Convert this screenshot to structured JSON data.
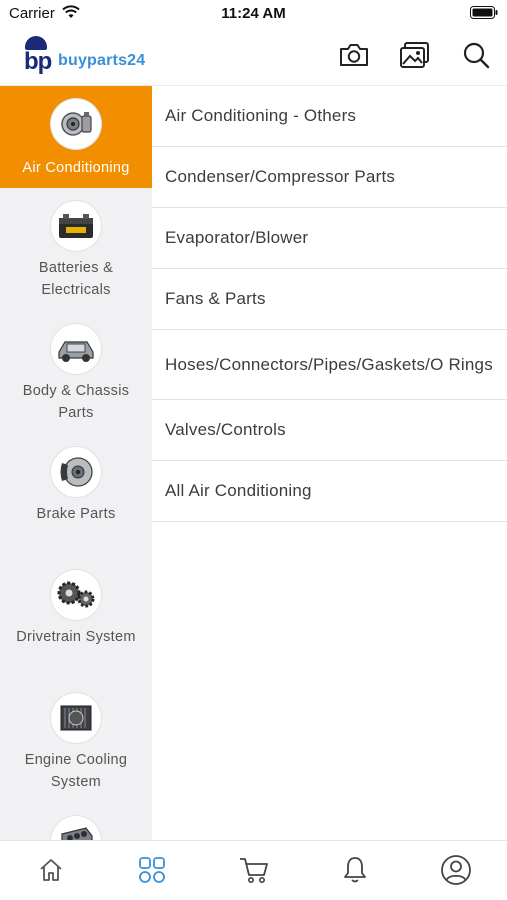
{
  "status_bar": {
    "carrier": "Carrier",
    "time": "11:24 AM"
  },
  "header": {
    "logo_mark": "bp",
    "logo_text": "buyparts",
    "logo_num": "24",
    "icons": [
      "camera-icon",
      "gallery-icon",
      "search-icon"
    ]
  },
  "categories": [
    {
      "label": "Air Conditioning",
      "icon": "ac-compressor-icon",
      "active": true
    },
    {
      "label": "Batteries & Electricals",
      "icon": "battery-icon"
    },
    {
      "label": "Body & Chassis Parts",
      "icon": "chassis-icon"
    },
    {
      "label": "Brake Parts",
      "icon": "brake-disc-icon"
    },
    {
      "label": "Drivetrain System",
      "icon": "gears-icon"
    },
    {
      "label": "Engine Cooling System",
      "icon": "radiator-icon"
    },
    {
      "label": "",
      "icon": "engine-block-icon"
    }
  ],
  "subcategories": [
    "Air Conditioning - Others",
    "Condenser/Compressor Parts",
    "Evaporator/Blower",
    "Fans & Parts",
    "Hoses/Connectors/Pipes/Gaskets/O Rings",
    "Valves/Controls",
    "All Air Conditioning"
  ],
  "tabbar": {
    "tabs": [
      "home-icon",
      "categories-icon",
      "cart-icon",
      "bell-icon",
      "profile-icon"
    ],
    "active_index": 1
  },
  "colors": {
    "accent": "#f18f01",
    "brand": "#1a2a78",
    "brand_light": "#3a8fd8",
    "tab_active": "#3a8fd8",
    "sidebar_bg": "#f1f1f4"
  }
}
